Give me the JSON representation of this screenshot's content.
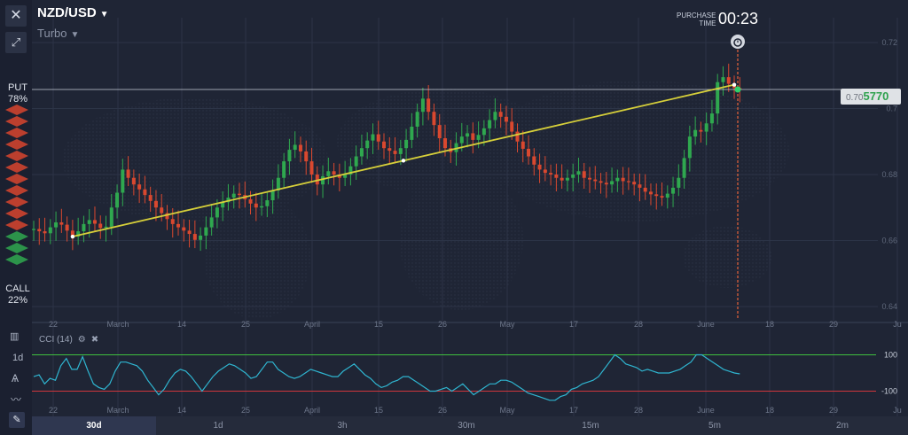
{
  "asset": {
    "pair": "NZD/USD",
    "mode": "Turbo"
  },
  "put": {
    "label": "PUT",
    "percent": "78%"
  },
  "call": {
    "label": "CALL",
    "percent": "22%"
  },
  "purchase": {
    "line1": "PURCHASE",
    "line2": "TIME",
    "timer": "00:23"
  },
  "price": {
    "prefix": "0.70",
    "highlight": "5770"
  },
  "y_axis": [
    "0.72",
    "0.7",
    "0.68",
    "0.66",
    "0.64"
  ],
  "x_axis": [
    "22",
    "March",
    "14",
    "25",
    "April",
    "15",
    "26",
    "May",
    "17",
    "28",
    "June",
    "18",
    "29",
    "Ju"
  ],
  "indicator": {
    "name": "CCI (14)",
    "level_high": "100",
    "level_low": "-100"
  },
  "side_tools": [
    "1d"
  ],
  "timeframes": [
    "30d",
    "1d",
    "3h",
    "30m",
    "15m",
    "5m",
    "2m"
  ],
  "active_timeframe": "30d",
  "colors": {
    "bull": "#2fa84f",
    "bear": "#d9482f",
    "trend": "#d6cf3a",
    "cci": "#2fb5d0",
    "upper": "#3fbf3f",
    "lower": "#d0363b",
    "expiry": "#e8643a"
  },
  "chart_data": {
    "type": "candlestick",
    "ylim": [
      0.64,
      0.72
    ],
    "y_ticks": [
      0.72,
      0.7,
      0.68,
      0.66,
      0.64
    ],
    "close_start": 0.6632,
    "closes": [
      0.6635,
      0.6628,
      0.6622,
      0.664,
      0.6655,
      0.6648,
      0.663,
      0.6612,
      0.6628,
      0.665,
      0.6662,
      0.6651,
      0.6638,
      0.6642,
      0.67,
      0.6745,
      0.6815,
      0.679,
      0.677,
      0.6755,
      0.6738,
      0.672,
      0.67,
      0.6683,
      0.6665,
      0.665,
      0.664,
      0.663,
      0.662,
      0.6602,
      0.6615,
      0.664,
      0.667,
      0.67,
      0.6716,
      0.673,
      0.6742,
      0.6738,
      0.6725,
      0.6712,
      0.67,
      0.6704,
      0.6722,
      0.6752,
      0.679,
      0.684,
      0.6875,
      0.689,
      0.687,
      0.684,
      0.68,
      0.677,
      0.6795,
      0.681,
      0.68,
      0.679,
      0.68,
      0.6825,
      0.6855,
      0.688,
      0.6903,
      0.6922,
      0.69,
      0.688,
      0.6872,
      0.6862,
      0.688,
      0.6905,
      0.6945,
      0.699,
      0.703,
      0.699,
      0.695,
      0.691,
      0.688,
      0.6868,
      0.6895,
      0.6915,
      0.6925,
      0.6905,
      0.692,
      0.694,
      0.6965,
      0.699,
      0.6975,
      0.696,
      0.693,
      0.69,
      0.6878,
      0.6855,
      0.683,
      0.6815,
      0.6805,
      0.68,
      0.679,
      0.6782,
      0.679,
      0.68,
      0.681,
      0.679,
      0.6785,
      0.678,
      0.6775,
      0.677,
      0.678,
      0.679,
      0.678,
      0.6778,
      0.677,
      0.676,
      0.6748,
      0.674,
      0.6735,
      0.673,
      0.6742,
      0.676,
      0.679,
      0.685,
      0.6915,
      0.6935,
      0.693,
      0.6955,
      0.6985,
      0.708,
      0.7095,
      0.7075,
      0.7062,
      0.706
    ],
    "trendline": {
      "from": {
        "index": 7,
        "price": 0.6612
      },
      "to": {
        "index": 126,
        "price": 0.7072
      }
    },
    "current_price": 0.70577
  },
  "cci_data": [
    -20,
    -10,
    -60,
    -30,
    -40,
    40,
    80,
    20,
    20,
    90,
    10,
    -60,
    -80,
    -90,
    -60,
    10,
    60,
    60,
    50,
    40,
    10,
    -40,
    -80,
    -120,
    -90,
    -40,
    0,
    20,
    10,
    -20,
    -60,
    -100,
    -60,
    -20,
    10,
    30,
    50,
    40,
    20,
    0,
    -30,
    -20,
    20,
    60,
    60,
    20,
    0,
    -20,
    -30,
    -20,
    0,
    20,
    10,
    0,
    -10,
    -20,
    -20,
    10,
    30,
    50,
    20,
    -10,
    -30,
    -60,
    -80,
    -70,
    -50,
    -40,
    -20,
    -20,
    -40,
    -60,
    -80,
    -100,
    -100,
    -90,
    -80,
    -100,
    -80,
    -60,
    -90,
    -120,
    -100,
    -80,
    -60,
    -60,
    -40,
    -40,
    -50,
    -70,
    -90,
    -110,
    -120,
    -130,
    -140,
    -150,
    -150,
    -130,
    -120,
    -90,
    -80,
    -60,
    -50,
    -40,
    -20,
    20,
    60,
    100,
    80,
    50,
    40,
    30,
    10,
    20,
    10,
    0,
    0,
    0,
    10,
    20,
    40,
    60,
    100,
    100,
    80,
    60,
    40,
    20,
    10,
    0,
    -5
  ]
}
